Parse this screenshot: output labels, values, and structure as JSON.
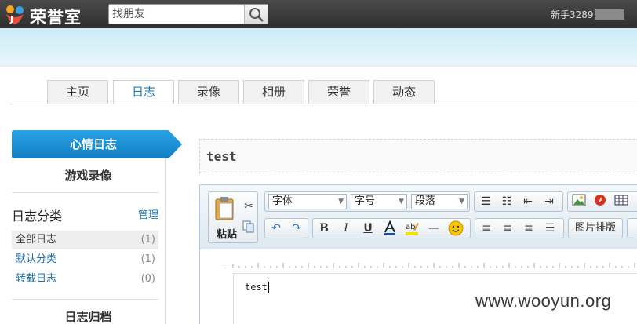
{
  "header": {
    "site_name": "荣誉室",
    "search_placeholder": "找朋友",
    "user_name": "新手3289"
  },
  "tabs": [
    {
      "label": "主页"
    },
    {
      "label": "日志"
    },
    {
      "label": "录像"
    },
    {
      "label": "相册"
    },
    {
      "label": "荣誉"
    },
    {
      "label": "动态"
    }
  ],
  "active_tab": "日志",
  "sidebar": {
    "active_item": "心情日志",
    "item_2": "游戏录像",
    "category_title": "日志分类",
    "manage_label": "管理",
    "categories": [
      {
        "name": "全部日志",
        "count": "(1)"
      },
      {
        "name": "默认分类",
        "count": "(1)"
      },
      {
        "name": "转载日志",
        "count": "(0)"
      }
    ],
    "archive_title": "日志归档"
  },
  "post": {
    "title_value": "test",
    "body_value": "test"
  },
  "toolbar": {
    "paste_label": "粘贴",
    "font_select": "字体",
    "size_select": "字号",
    "paragraph_select": "段落",
    "image_layout_label": "图片排版"
  },
  "watermark": "www.wooyun.org",
  "colors": {
    "accent": "#1b78b5",
    "active_button": "#1a8fd3",
    "banner": "#d3eef8"
  }
}
